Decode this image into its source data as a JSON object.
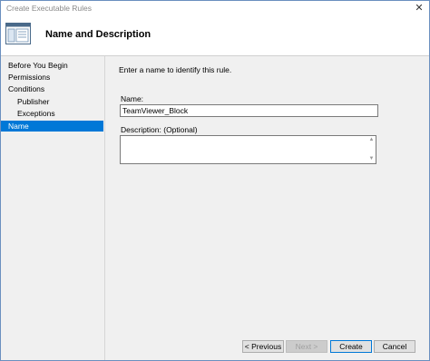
{
  "window": {
    "title": "Create Executable Rules",
    "close_glyph": "✕"
  },
  "header": {
    "title": "Name and Description",
    "icon": "wizard-page-icon"
  },
  "sidebar": {
    "items": [
      {
        "label": "Before You Begin",
        "indent": false,
        "selected": false
      },
      {
        "label": "Permissions",
        "indent": false,
        "selected": false
      },
      {
        "label": "Conditions",
        "indent": false,
        "selected": false
      },
      {
        "label": "Publisher",
        "indent": true,
        "selected": false
      },
      {
        "label": "Exceptions",
        "indent": true,
        "selected": false
      },
      {
        "label": "Name",
        "indent": false,
        "selected": true
      }
    ]
  },
  "main": {
    "intro": "Enter a name to identify this rule.",
    "name_label": "Name:",
    "name_value": "TeamViewer_Block",
    "description_label": "Description: (Optional)",
    "description_value": ""
  },
  "footer": {
    "previous_label": "< Previous",
    "next_label": "Next >",
    "create_label": "Create",
    "cancel_label": "Cancel"
  },
  "colors": {
    "selection": "#0078d7",
    "panel": "#f0f0f0"
  }
}
